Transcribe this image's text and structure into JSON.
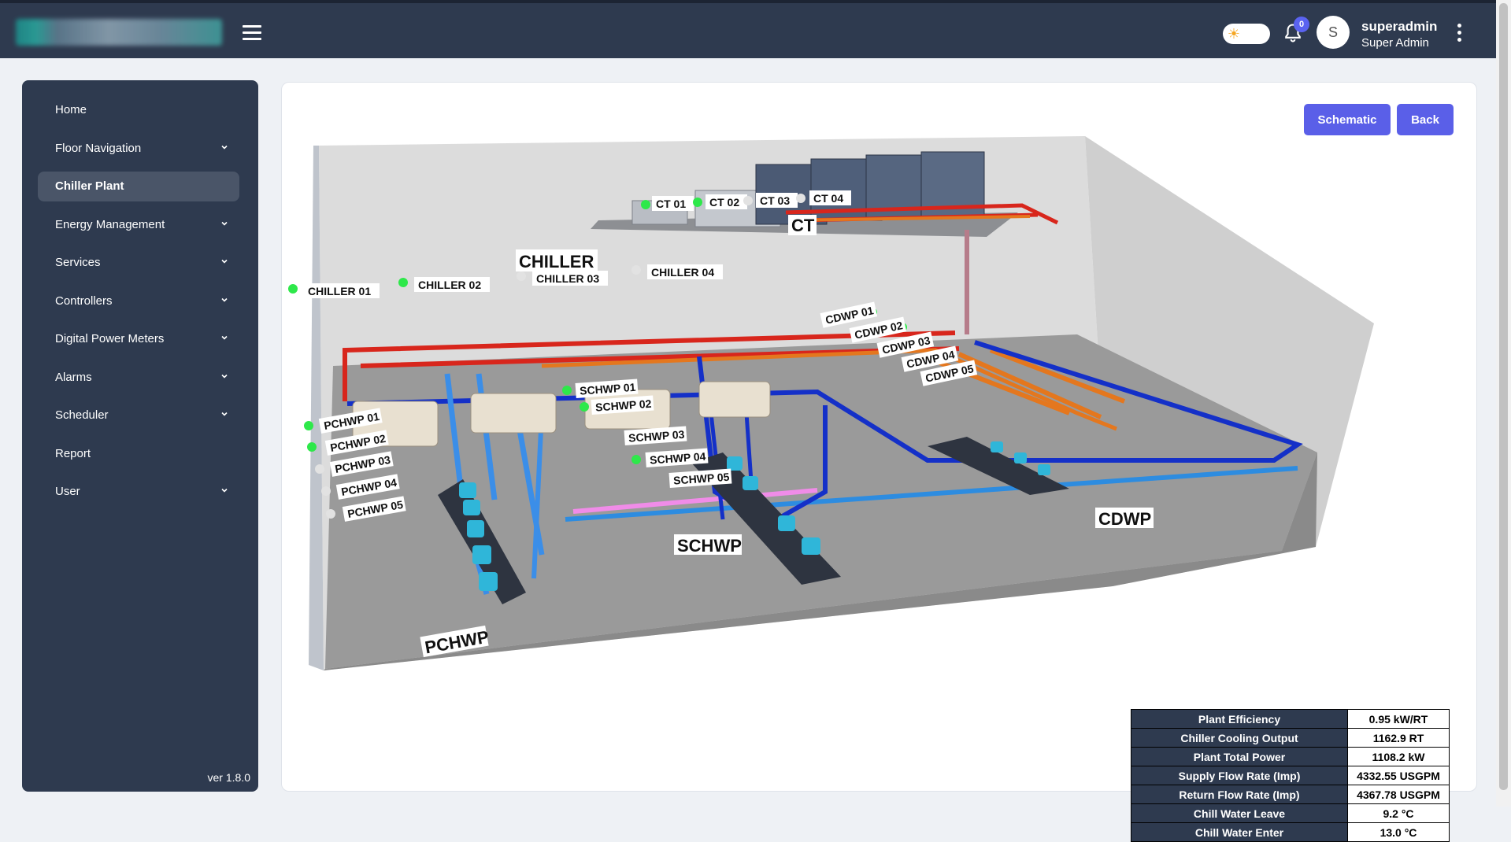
{
  "header": {
    "notifications_count": "0",
    "avatar_initial": "S",
    "username": "superadmin",
    "role": "Super Admin"
  },
  "sidebar": {
    "items": [
      {
        "label": "Home",
        "has_submenu": false
      },
      {
        "label": "Floor Navigation",
        "has_submenu": true
      },
      {
        "label": "Chiller Plant",
        "has_submenu": false,
        "active": true
      },
      {
        "label": "Energy Management",
        "has_submenu": true
      },
      {
        "label": "Services",
        "has_submenu": true
      },
      {
        "label": "Controllers",
        "has_submenu": true
      },
      {
        "label": "Digital Power Meters",
        "has_submenu": true
      },
      {
        "label": "Alarms",
        "has_submenu": true
      },
      {
        "label": "Scheduler",
        "has_submenu": true
      },
      {
        "label": "Report",
        "has_submenu": false
      },
      {
        "label": "User",
        "has_submenu": true
      }
    ],
    "version": "ver 1.8.0"
  },
  "actions": {
    "schematic_label": "Schematic",
    "back_label": "Back"
  },
  "plant": {
    "group_labels": {
      "ct": "CT",
      "chiller": "CHILLER",
      "cdwp": "CDWP",
      "schwp": "SCHWP",
      "pchwp": "PCHWP"
    },
    "equipment": {
      "ct01": {
        "label": "CT 01",
        "status": "on"
      },
      "ct02": {
        "label": "CT 02",
        "status": "on"
      },
      "ct03": {
        "label": "CT 03",
        "status": "off"
      },
      "ct04": {
        "label": "CT 04",
        "status": "off"
      },
      "ch01": {
        "label": "CHILLER 01",
        "status": "on"
      },
      "ch02": {
        "label": "CHILLER 02",
        "status": "on"
      },
      "ch03": {
        "label": "CHILLER 03",
        "status": "off"
      },
      "ch04": {
        "label": "CHILLER 04",
        "status": "off"
      },
      "cdwp01": {
        "label": "CDWP 01",
        "status": "on"
      },
      "cdwp02": {
        "label": "CDWP 02",
        "status": "on"
      },
      "cdwp03": {
        "label": "CDWP 03",
        "status": "off"
      },
      "cdwp04": {
        "label": "CDWP 04",
        "status": "off"
      },
      "cdwp05": {
        "label": "CDWP 05",
        "status": "off"
      },
      "schwp01": {
        "label": "SCHWP 01",
        "status": "on"
      },
      "schwp02": {
        "label": "SCHWP 02",
        "status": "on"
      },
      "schwp03": {
        "label": "SCHWP 03",
        "status": "none"
      },
      "schwp04": {
        "label": "SCHWP 04",
        "status": "on"
      },
      "schwp05": {
        "label": "SCHWP 05",
        "status": "none"
      },
      "pchwp01": {
        "label": "PCHWP 01",
        "status": "on"
      },
      "pchwp02": {
        "label": "PCHWP 02",
        "status": "on"
      },
      "pchwp03": {
        "label": "PCHWP 03",
        "status": "off"
      },
      "pchwp04": {
        "label": "PCHWP 04",
        "status": "off"
      },
      "pchwp05": {
        "label": "PCHWP 05",
        "status": "off"
      }
    },
    "status_colors": {
      "on": "#2ee84a",
      "off": "#e2e2e2"
    }
  },
  "stats": [
    {
      "label": "Plant Efficiency",
      "value": "0.95 kW/RT"
    },
    {
      "label": "Chiller Cooling Output",
      "value": "1162.9 RT"
    },
    {
      "label": "Plant Total Power",
      "value": "1108.2 kW"
    },
    {
      "label": "Supply Flow Rate (Imp)",
      "value": "4332.55 USGPM"
    },
    {
      "label": "Return Flow Rate (Imp)",
      "value": "4367.78 USGPM"
    },
    {
      "label": "Chill Water Leave",
      "value": "9.2 °C"
    },
    {
      "label": "Chill Water Enter",
      "value": "13.0 °C"
    }
  ]
}
